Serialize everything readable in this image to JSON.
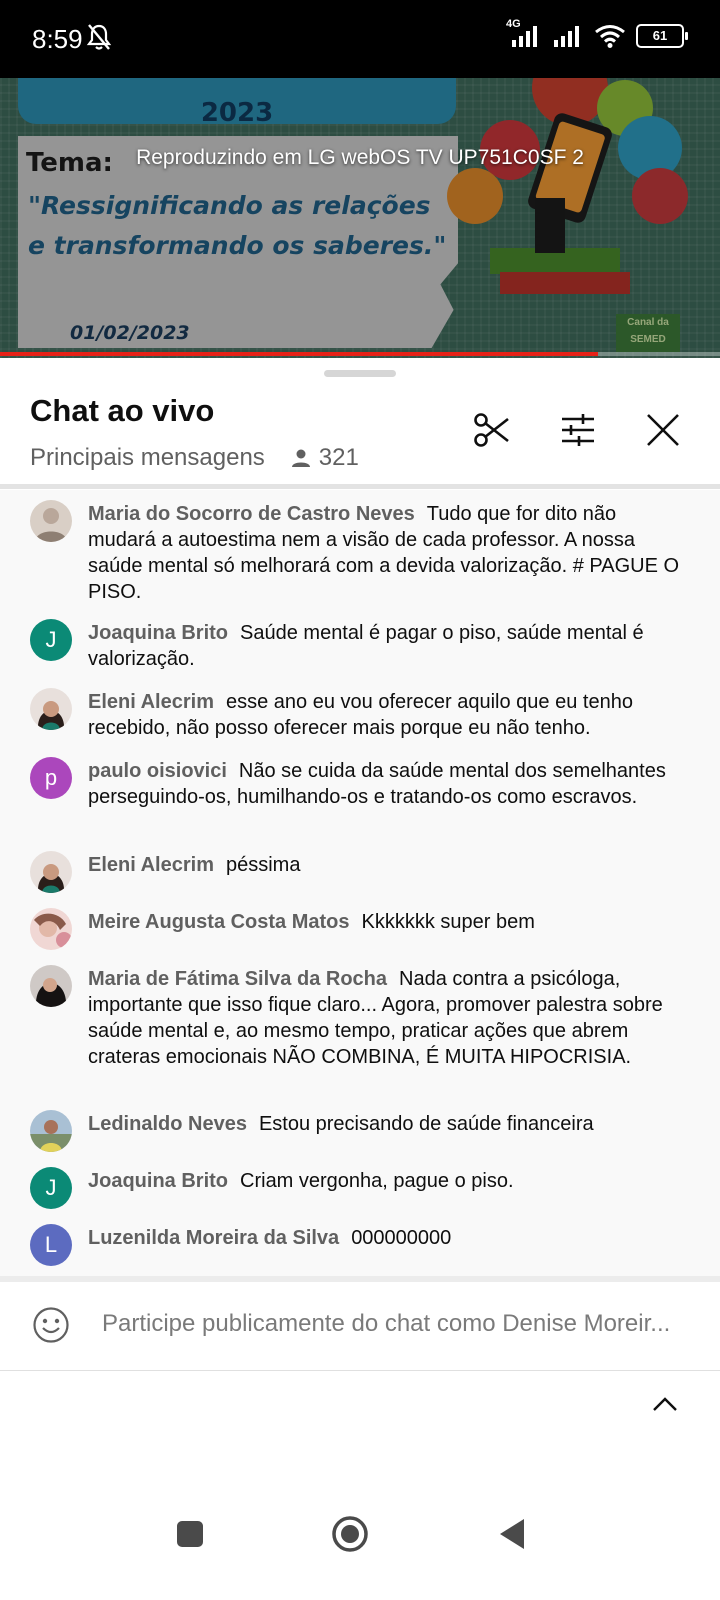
{
  "status_bar": {
    "time": "8:59",
    "network_tag": "4G",
    "battery": "61",
    "icons": [
      "notifications-off-icon",
      "signal-icon",
      "signal-icon",
      "wifi-icon",
      "battery-icon"
    ]
  },
  "video": {
    "year": "2023",
    "theme_label": "Tema:",
    "slogan": "\"Ressignificando as relações e transformando os saberes.\"",
    "date": "01/02/2023",
    "channel_badge_line1": "Canal da",
    "channel_badge_line2": "SEMED",
    "casting_text": "Reproduzindo em LG webOS TV UP751C0SF 2",
    "progress": 0.83,
    "progress_color": "#e62117"
  },
  "chat": {
    "title": "Chat ao vivo",
    "subtitle": "Principais mensagens",
    "viewers": "321",
    "actions": [
      "scissors-icon",
      "tune-icon",
      "close-icon"
    ],
    "messages": [
      {
        "author": "Maria do Socorro de Castro Neves",
        "text": "Tudo que for dito não mudará a autoestima nem a visão de cada professor. A nossa saúde mental só melhorará com a devida valorização. # PAGUE O PISO.",
        "avatar": "photo",
        "avatar_color": "#b9a79a"
      },
      {
        "author": "Joaquina Brito",
        "text": "Saúde mental é pagar o piso, saúde mental é valorização.",
        "avatar": "J",
        "avatar_color": "#0b8a76"
      },
      {
        "author": "Eleni Alecrim",
        "text": "esse ano eu vou oferecer aquilo que eu tenho recebido, não posso oferecer mais porque eu não tenho.",
        "avatar": "photo",
        "avatar_color": "#6a4d3f"
      },
      {
        "author": "paulo oisiovici",
        "text": "Não se cuida da saúde mental dos semelhantes perseguindo-os, humilhando-os e tratando-os como escravos.",
        "avatar": "p",
        "avatar_color": "#ab47bc"
      },
      {
        "author": "Eleni Alecrim",
        "text": "péssima",
        "avatar": "photo",
        "avatar_color": "#6a4d3f"
      },
      {
        "author": "Meire Augusta Costa Matos",
        "text": "Kkkkkkk super bem",
        "avatar": "photo",
        "avatar_color": "#d8a7a3"
      },
      {
        "author": "Maria de Fátima Silva da Rocha",
        "text": "Nada contra a psicóloga, importante que isso fique claro... Agora, promover palestra sobre saúde mental e, ao mesmo tempo, praticar ações que abrem crateras emocionais NÃO COMBINA, É MUITA HIPOCRISIA.",
        "avatar": "photo",
        "avatar_color": "#2b2422"
      },
      {
        "author": "Ledinaldo Neves",
        "text": "Estou precisando de saúde financeira",
        "avatar": "photo",
        "avatar_color": "#7b8f6a"
      },
      {
        "author": "Joaquina Brito",
        "text": "Criam vergonha, pague o piso.",
        "avatar": "J",
        "avatar_color": "#0b8a76"
      },
      {
        "author": "Luzenilda Moreira da Silva",
        "text": "000000000",
        "avatar": "L",
        "avatar_color": "#5c6bc0"
      }
    ],
    "input_placeholder": "Participe publicamente do chat como Denise Moreir..."
  },
  "nav_bar": {
    "buttons": [
      "recents-button",
      "home-button",
      "back-button"
    ]
  }
}
